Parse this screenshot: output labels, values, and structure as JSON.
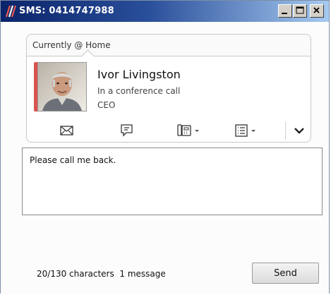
{
  "window": {
    "title": "SMS: 0414747988",
    "controls": {
      "minimize": "minimize-icon",
      "maximize": "maximize-icon",
      "close": "close-icon"
    }
  },
  "status": {
    "location_text": "Currently @ Home"
  },
  "contact": {
    "name": "Ivor Livingston",
    "status": "In a conference call",
    "title": "CEO",
    "presence_color": "#d9534f"
  },
  "toolbar": {
    "items": [
      "mail-icon",
      "chat-icon",
      "phone-icon",
      "details-icon",
      "expand-icon"
    ]
  },
  "message": {
    "text": "Please call me back."
  },
  "footer": {
    "char_count": "20/130 characters",
    "message_count": "1 message",
    "send_label": "Send"
  }
}
